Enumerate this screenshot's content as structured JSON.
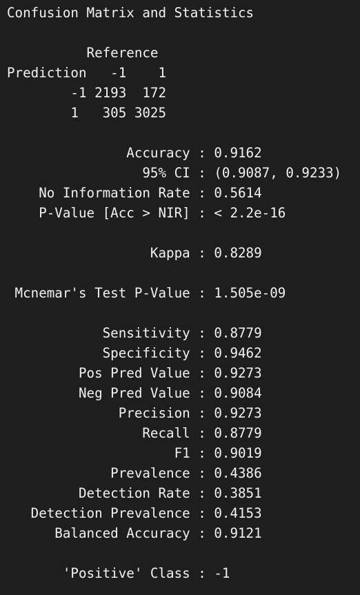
{
  "output": {
    "lines": [
      "Confusion Matrix and Statistics",
      "",
      "          Reference",
      "Prediction   -1    1",
      "        -1 2193  172",
      "        1   305 3025",
      "",
      "               Accuracy : 0.9162",
      "                 95% CI : (0.9087, 0.9233)",
      "    No Information Rate : 0.5614",
      "    P-Value [Acc > NIR] : < 2.2e-16",
      "",
      "                  Kappa : 0.8289",
      "",
      " Mcnemar's Test P-Value : 1.505e-09",
      "",
      "            Sensitivity : 0.8779",
      "            Specificity : 0.9462",
      "         Pos Pred Value : 0.9273",
      "         Neg Pred Value : 0.9084",
      "              Precision : 0.9273",
      "                 Recall : 0.8779",
      "                     F1 : 0.9019",
      "             Prevalence : 0.4386",
      "         Detection Rate : 0.3851",
      "   Detection Prevalence : 0.4153",
      "      Balanced Accuracy : 0.9121",
      "",
      "       'Positive' Class : -1"
    ]
  }
}
